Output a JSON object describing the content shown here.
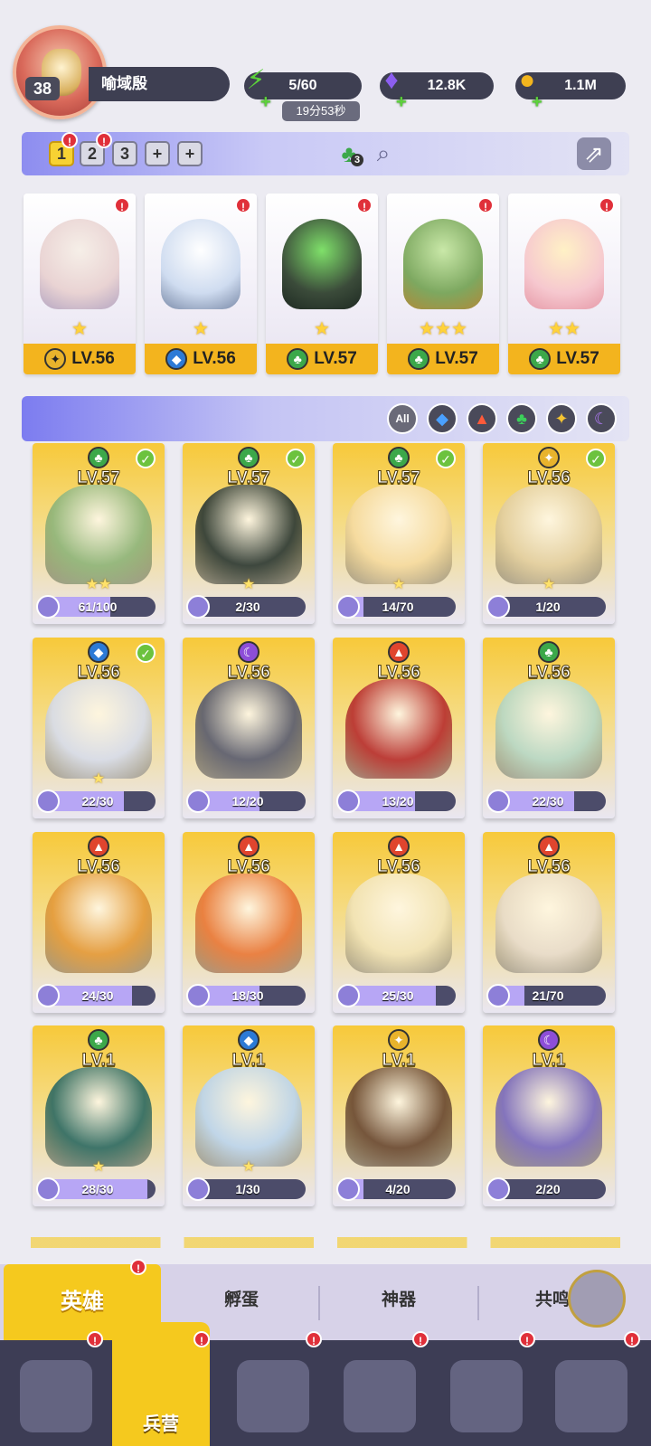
{
  "player": {
    "level": "38",
    "name": "喻域殷"
  },
  "resources": {
    "energy": "5/60",
    "energy_timer": "19分53秒",
    "gems": "12.8K",
    "gold": "1.1M"
  },
  "team_slots": [
    "1",
    "2",
    "3",
    "+",
    "+"
  ],
  "team_bar": {
    "element_count": "3"
  },
  "team_heroes": [
    {
      "level": "LV.56",
      "element": "light",
      "stars": "★",
      "color": "#e9d3d3"
    },
    {
      "level": "LV.56",
      "element": "water",
      "stars": "★",
      "color": "#cfdcf0"
    },
    {
      "level": "LV.57",
      "element": "nature",
      "stars": "★",
      "color": "#3b4b3a"
    },
    {
      "level": "LV.57",
      "element": "nature",
      "stars": "★★★",
      "color": "#7da860"
    },
    {
      "level": "LV.57",
      "element": "nature",
      "stars": "★★",
      "color": "#f6c8cf"
    }
  ],
  "filters": [
    "All",
    "water",
    "fire",
    "nature",
    "light",
    "dark"
  ],
  "heroes": [
    {
      "level": "LV.57",
      "element": "nature",
      "progress": "61/100",
      "fill": 0.61,
      "checked": true,
      "stars": "★★",
      "color": "#8fb57a"
    },
    {
      "level": "LV.57",
      "element": "nature",
      "progress": "2/30",
      "fill": 0.07,
      "checked": true,
      "stars": "★",
      "color": "#2e3a34"
    },
    {
      "level": "LV.57",
      "element": "nature",
      "progress": "14/70",
      "fill": 0.2,
      "checked": true,
      "stars": "★",
      "color": "#f6dba0"
    },
    {
      "level": "LV.56",
      "element": "light",
      "progress": "1/20",
      "fill": 0.05,
      "checked": true,
      "stars": "★",
      "color": "#e3cfa0"
    },
    {
      "level": "LV.56",
      "element": "water",
      "progress": "22/30",
      "fill": 0.73,
      "checked": true,
      "stars": "★",
      "color": "#d7dcea"
    },
    {
      "level": "LV.56",
      "element": "dark",
      "progress": "12/20",
      "fill": 0.6,
      "checked": false,
      "stars": "",
      "color": "#5b5d6e"
    },
    {
      "level": "LV.56",
      "element": "fire",
      "progress": "13/20",
      "fill": 0.65,
      "checked": false,
      "stars": "",
      "color": "#b8302e"
    },
    {
      "level": "LV.56",
      "element": "nature",
      "progress": "22/30",
      "fill": 0.73,
      "checked": false,
      "stars": "",
      "color": "#b8d8c5"
    },
    {
      "level": "LV.56",
      "element": "fire",
      "progress": "24/30",
      "fill": 0.8,
      "checked": false,
      "stars": "",
      "color": "#e49a3a"
    },
    {
      "level": "LV.56",
      "element": "fire",
      "progress": "18/30",
      "fill": 0.6,
      "checked": false,
      "stars": "",
      "color": "#e9793a"
    },
    {
      "level": "LV.56",
      "element": "fire",
      "progress": "25/30",
      "fill": 0.83,
      "checked": false,
      "stars": "",
      "color": "#f2e4b7"
    },
    {
      "level": "LV.56",
      "element": "fire",
      "progress": "21/70",
      "fill": 0.3,
      "checked": false,
      "stars": "",
      "color": "#e8dccb"
    },
    {
      "level": "LV.1",
      "element": "nature",
      "progress": "28/30",
      "fill": 0.93,
      "checked": false,
      "stars": "★",
      "color": "#2f6b63"
    },
    {
      "level": "LV.1",
      "element": "water",
      "progress": "1/30",
      "fill": 0.03,
      "checked": false,
      "stars": "★",
      "color": "#bcd5ee"
    },
    {
      "level": "LV.1",
      "element": "light",
      "progress": "4/20",
      "fill": 0.2,
      "checked": false,
      "stars": "",
      "color": "#6b4a33"
    },
    {
      "level": "LV.1",
      "element": "dark",
      "progress": "2/20",
      "fill": 0.1,
      "checked": false,
      "stars": "",
      "color": "#7a6bc0"
    }
  ],
  "sub_tabs": [
    "英雄",
    "孵蛋",
    "神器",
    "共鸣"
  ],
  "bottom_nav": {
    "active_label": "兵营",
    "items": [
      "cards-icon",
      "barracks-icon",
      "book-icon",
      "castle-icon",
      "mushroom-icon",
      "banner-icon"
    ]
  },
  "colors": {
    "accent": "#f5c91e",
    "nav_bg": "#3d3d55",
    "badge_red": "#e0303a",
    "nature": "#3ca84a",
    "water": "#2c7ad6",
    "fire": "#e0452e",
    "light": "#e8b32c",
    "dark": "#8d4ed8"
  }
}
